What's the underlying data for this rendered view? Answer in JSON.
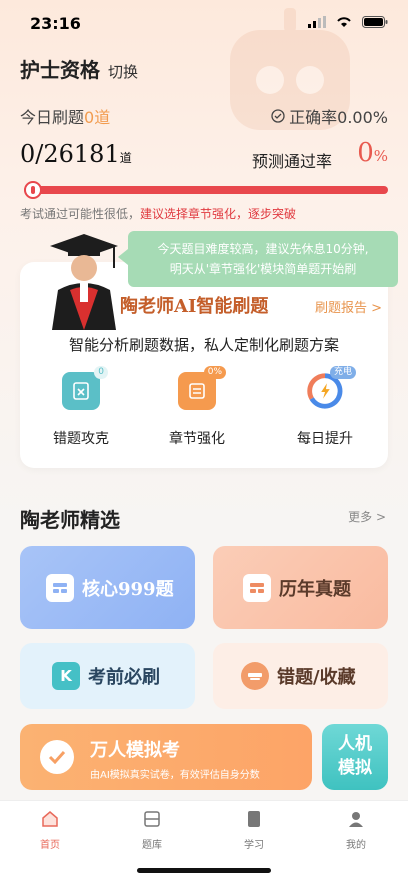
{
  "status_bar": {
    "time": "23:16"
  },
  "header": {
    "title": "护士资格",
    "switch_label": "切换"
  },
  "stats": {
    "today_label": "今日刷题",
    "today_count": "0道",
    "accuracy_label": "正确率0.00%",
    "progress_done": "0",
    "progress_total": "/26181",
    "progress_unit": "道",
    "pass_rate_label": "预测通过率",
    "pass_rate_value": "0",
    "pass_rate_unit": "%",
    "progress_fraction": 0
  },
  "hint": {
    "prefix": "考试通过可能性很低，",
    "highlight": "建议选择章节强化，逐步突破"
  },
  "bubble": {
    "line1": "今天题目难度较高，建议先休息10分钟,",
    "line2": "明天从'章节强化'模块简单题开始刷"
  },
  "ai_card": {
    "title": "陶老师AI智能刷题",
    "report_link": "刷题报告 >",
    "subtitle": "智能分析刷题数据，私人定制化刷题方案",
    "features": [
      {
        "label": "错题攻克",
        "badge": "0",
        "color": "#5bbfc7"
      },
      {
        "label": "章节强化",
        "badge": "0%",
        "color": "#f59a4e"
      },
      {
        "label": "每日提升",
        "badge": "充电",
        "color": "#4a8ae8"
      }
    ]
  },
  "selection": {
    "title": "陶老师精选",
    "more": "更多 >",
    "tiles": [
      {
        "label": "核心999题"
      },
      {
        "label": "历年真题"
      },
      {
        "label": "考前必刷",
        "icon_letter": "K"
      },
      {
        "label": "错题/收藏"
      }
    ],
    "mock": {
      "title": "万人模拟考",
      "subtitle": "由AI模拟真实试卷，有效评估自身分数"
    },
    "hm": {
      "line1": "人机",
      "line2": "模拟"
    }
  },
  "tabbar": {
    "items": [
      {
        "label": "首页"
      },
      {
        "label": "题库"
      },
      {
        "label": "学习"
      },
      {
        "label": "我的"
      }
    ]
  },
  "colors": {
    "accent": "#e8474c",
    "orange": "#f29c4f",
    "green_bubble": "#a6dbb5"
  }
}
